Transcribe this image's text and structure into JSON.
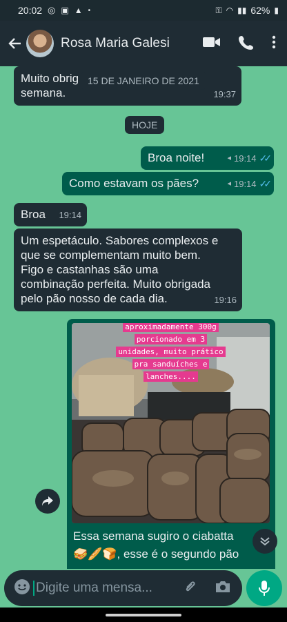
{
  "status_bar": {
    "time": "20:02",
    "battery": "62%"
  },
  "header": {
    "contact_name": "Rosa Maria Galesi"
  },
  "date_pills": {
    "floating": "15 DE JANEIRO DE 2021",
    "today": "HOJE"
  },
  "messages": [
    {
      "text_line1": "Muito obrig",
      "text_line2": "semana.",
      "time": "19:37"
    },
    {
      "text": "Broa noite!",
      "time": "19:14"
    },
    {
      "text": "Como estavam os pães?",
      "time": "19:14"
    },
    {
      "text": "Broa",
      "time": "19:14"
    },
    {
      "lines": [
        "Um espetáculo. Sabores complexos e",
        "que se complementam muito bem.",
        "Figo e castanhas são uma",
        "combinação perfeita. Muito obrigada",
        "pelo pão nosso de cada dia."
      ],
      "time": "19:16"
    },
    {
      "photo_caption_lines": [
        "aproximadamente 300g",
        "porcionado em 3",
        "unidades, muito prático",
        "pra sanduíches e",
        "lanches...."
      ],
      "lines": [
        "Essa semana sugiro o ciabatta",
        "🥪🥖🍞, esse é o segundo pão"
      ]
    }
  ],
  "composer": {
    "placeholder": "Digite uma mensa..."
  },
  "colors": {
    "background": "#67c596",
    "incoming": "#1f2c34",
    "outgoing": "#005c4b",
    "accent": "#00a884",
    "read_ticks": "#53bdeb"
  }
}
